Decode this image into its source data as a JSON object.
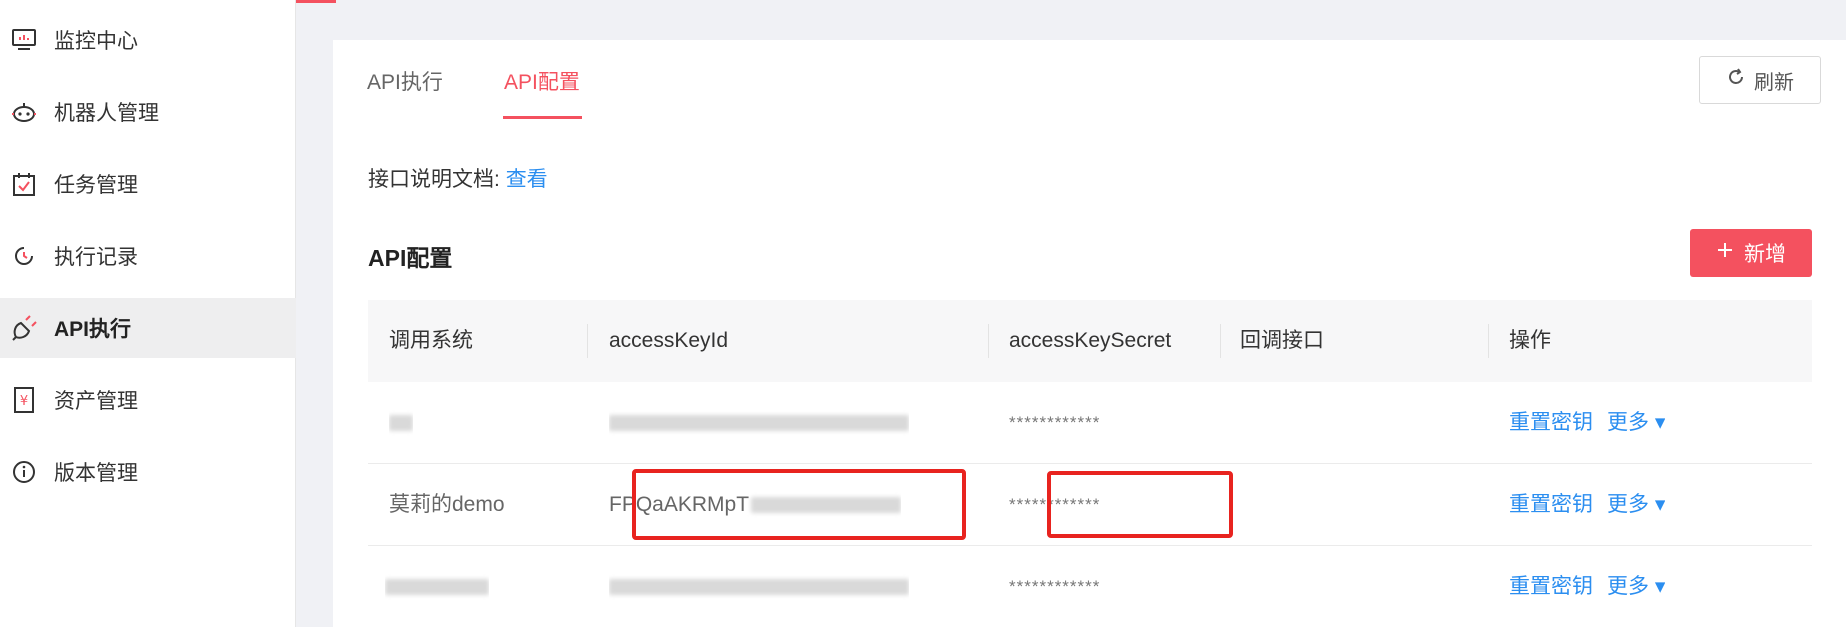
{
  "sidebar": {
    "items": [
      {
        "label": "监控中心",
        "icon": "monitor-icon",
        "active": false
      },
      {
        "label": "机器人管理",
        "icon": "robot-icon",
        "active": false
      },
      {
        "label": "任务管理",
        "icon": "calendar-check-icon",
        "active": false
      },
      {
        "label": "执行记录",
        "icon": "clock-history-icon",
        "active": false
      },
      {
        "label": "API执行",
        "icon": "api-icon",
        "active": true
      },
      {
        "label": "资产管理",
        "icon": "yen-document-icon",
        "active": false
      },
      {
        "label": "版本管理",
        "icon": "info-circle-icon",
        "active": false
      }
    ]
  },
  "tabs": [
    {
      "label": "API执行",
      "active": false
    },
    {
      "label": "API配置",
      "active": true
    }
  ],
  "refresh_label": "刷新",
  "doc": {
    "label": "接口说明文档:",
    "link": "查看"
  },
  "section_title": "API配置",
  "add_label": "新增",
  "table": {
    "headers": [
      "调用系统",
      "accessKeyId",
      "accessKeySecret",
      "回调接口",
      "操作"
    ],
    "rows": [
      {
        "system": "",
        "key_id": "",
        "secret": "************",
        "callback": "",
        "action": "重置密钥",
        "more": "更多"
      },
      {
        "system": "莫莉的demo",
        "key_id": "FPQaAKRMpT",
        "secret": "************",
        "callback": "",
        "action": "重置密钥",
        "more": "更多"
      },
      {
        "system": "",
        "key_id": "",
        "secret": "************",
        "callback": "",
        "action": "重置密钥",
        "more": "更多"
      }
    ]
  },
  "colors": {
    "accent": "#f4515f",
    "link": "#2b8ef0",
    "highlight_box": "#e8231f"
  }
}
